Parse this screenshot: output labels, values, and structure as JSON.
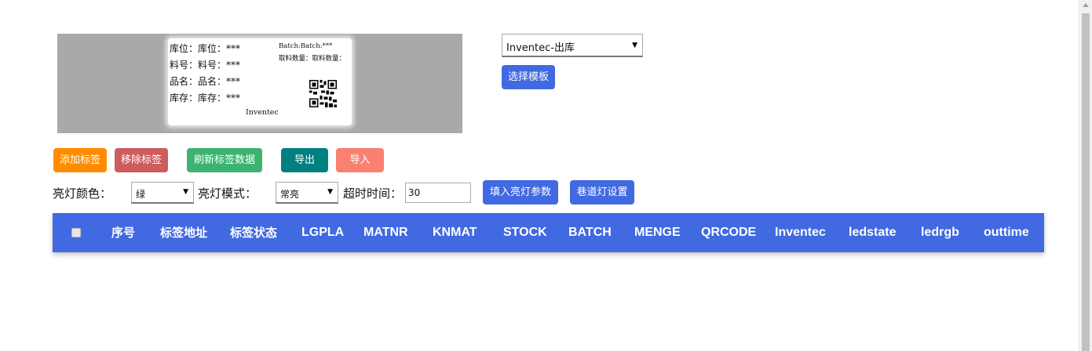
{
  "label_preview": {
    "lines": [
      "库位：库位：***",
      "料号：料号：***",
      "品名：品名：***",
      "库存：库存：***"
    ],
    "batch": "Batch:Batch:***",
    "qty": "取料数量：取料数量：",
    "footer": "Inventec"
  },
  "template": {
    "selected": "Inventec-出库",
    "button": "选择模板"
  },
  "toolbar": {
    "add": "添加标签",
    "remove": "移除标签",
    "refresh": "刷新标签数据",
    "export": "导出",
    "import": "导入"
  },
  "controls": {
    "color_label": "亮灯颜色：",
    "color_value": "绿",
    "mode_label": "亮灯模式：",
    "mode_value": "常亮",
    "timeout_label": "超时时间：",
    "timeout_value": "30",
    "fill_button": "填入亮灯参数",
    "lane_button": "巷道灯设置"
  },
  "table": {
    "columns": [
      "序号",
      "标签地址",
      "标签状态",
      "LGPLA",
      "MATNR",
      "KNMAT",
      "STOCK",
      "BATCH",
      "MENGE",
      "QRCODE",
      "Inventec",
      "ledstate",
      "ledrgb",
      "outtime"
    ]
  }
}
